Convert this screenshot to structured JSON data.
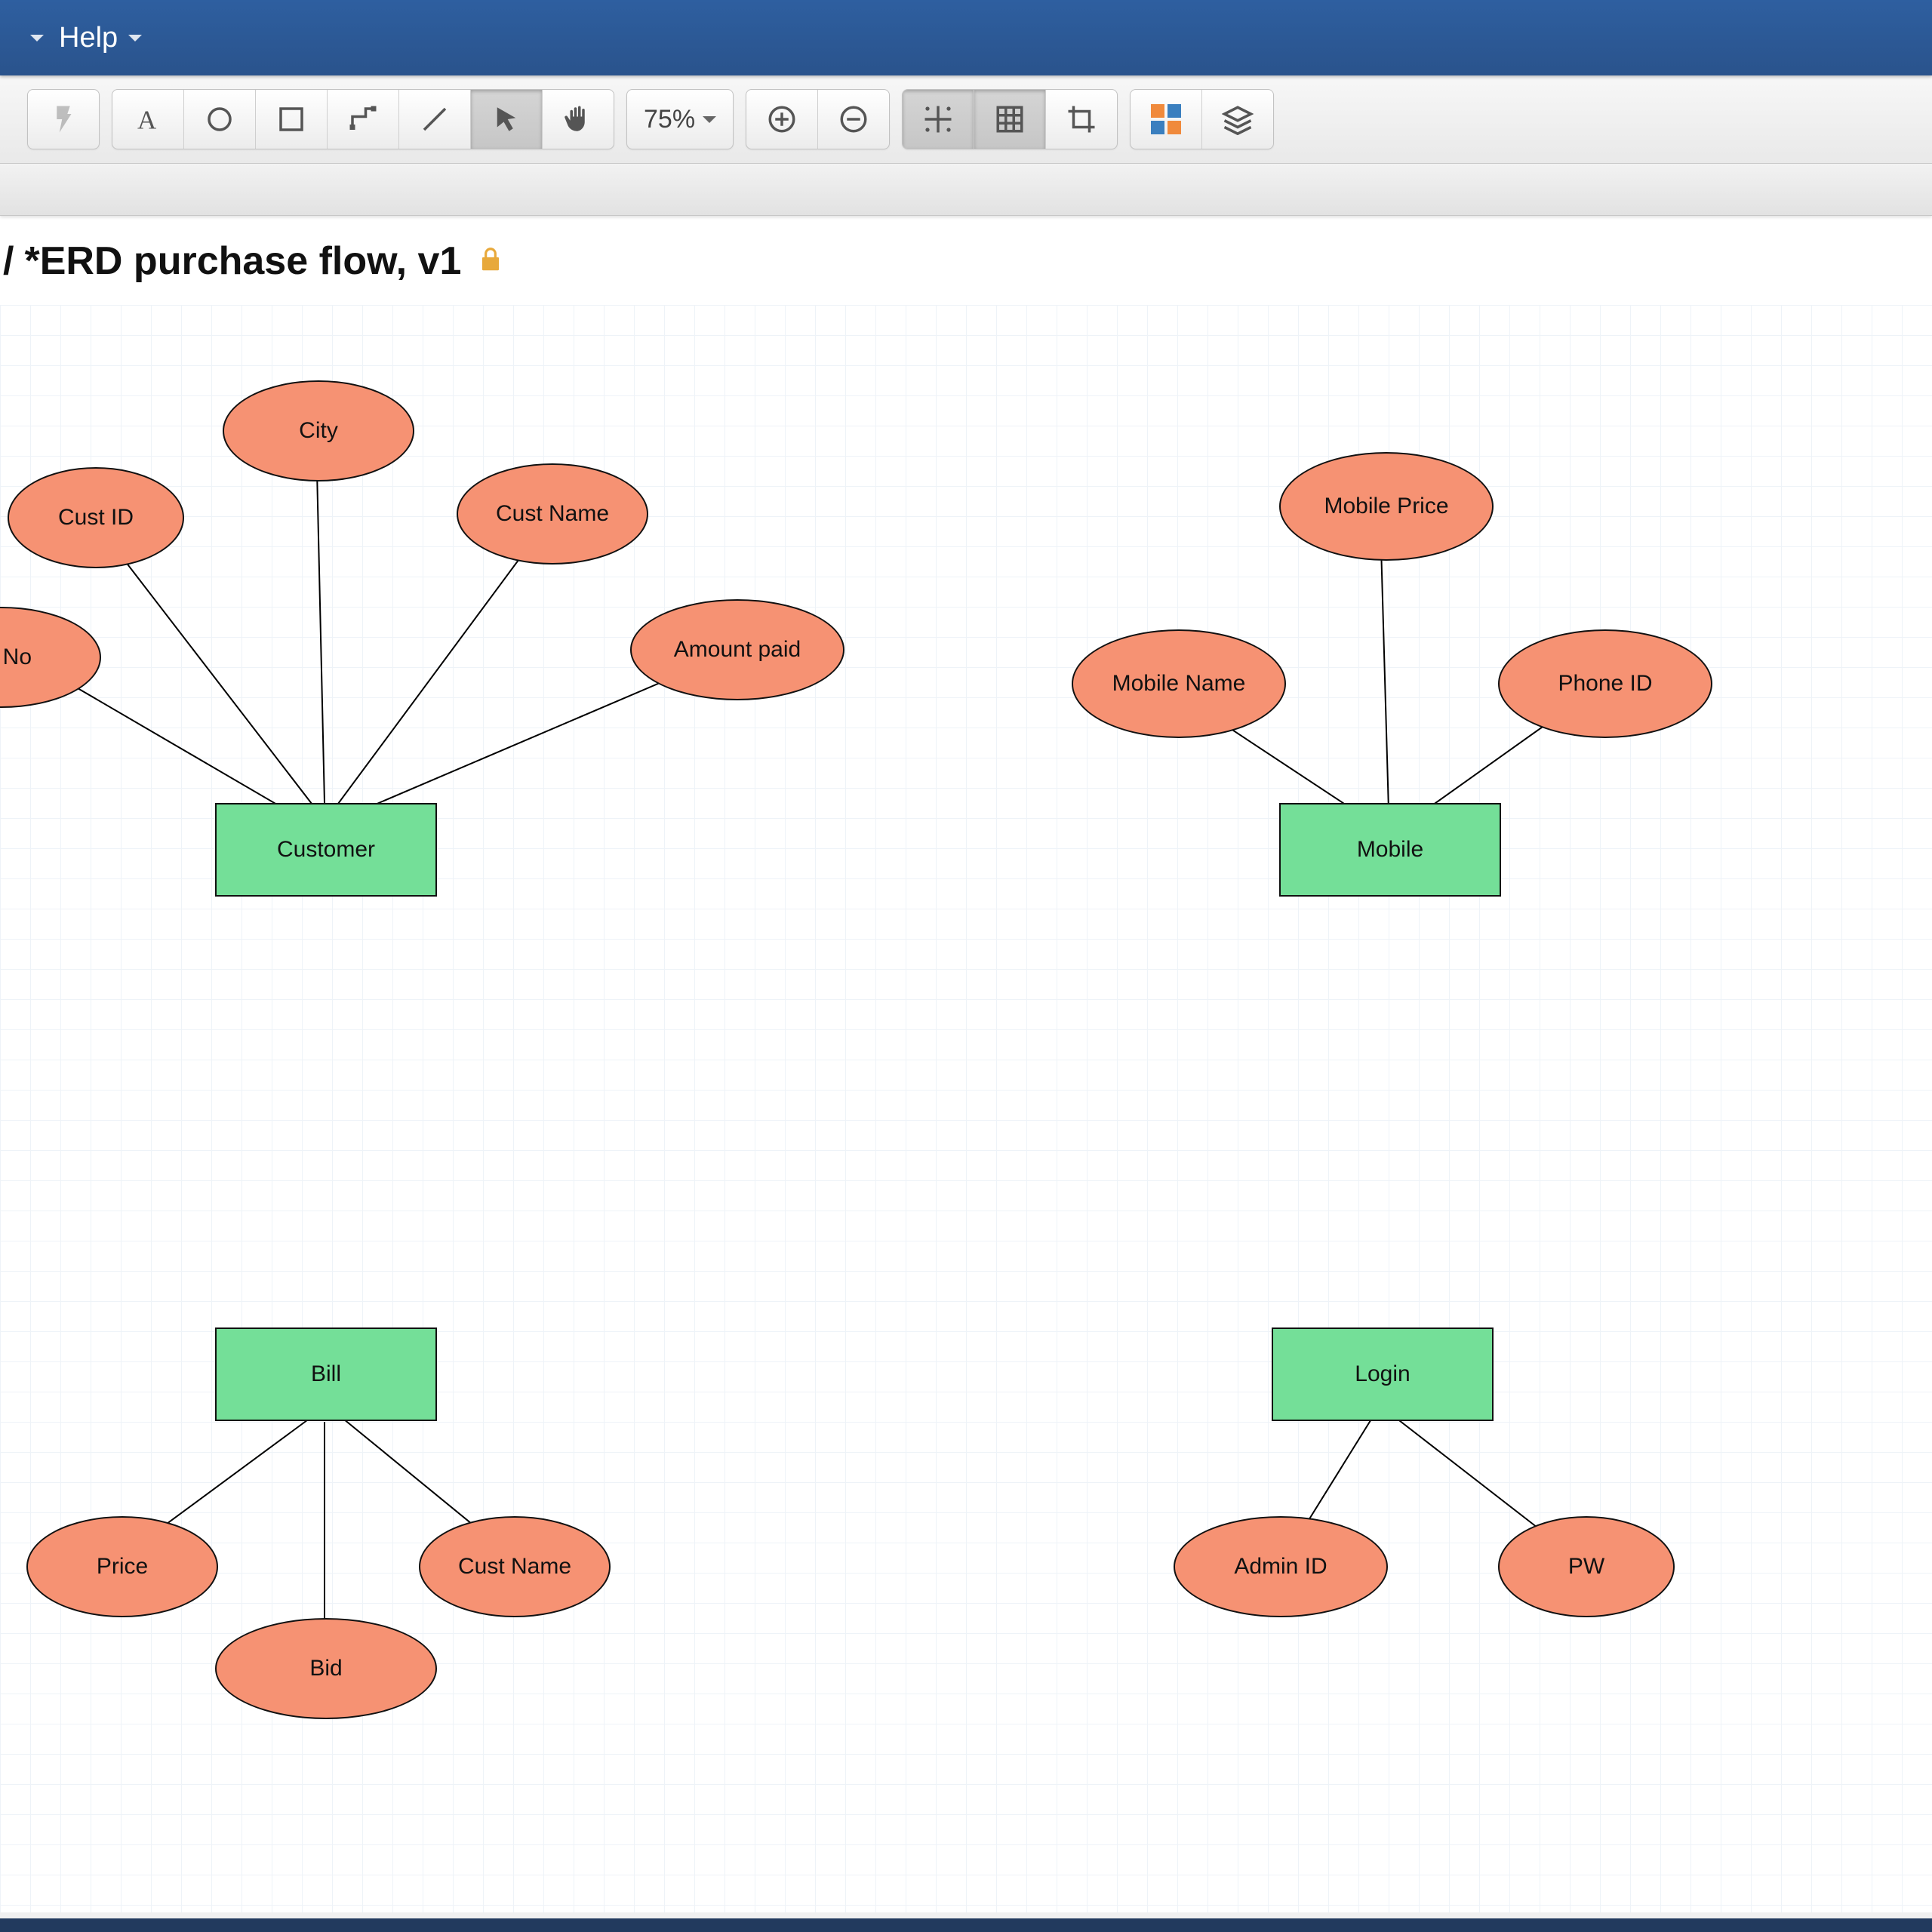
{
  "menubar": {
    "help": "Help"
  },
  "toolbar": {
    "zoom_label": "75%"
  },
  "breadcrumb": {
    "slash": "/"
  },
  "doc": {
    "title": "*ERD purchase flow, v1",
    "locked_icon": "lock-icon"
  },
  "erd": {
    "customer": {
      "entity": "Customer",
      "attrs": {
        "phone_no": "ne No",
        "cust_id": "Cust ID",
        "city": "City",
        "cust_name": "Cust Name",
        "amount_paid": "Amount paid"
      }
    },
    "mobile": {
      "entity": "Mobile",
      "attrs": {
        "mobile_name": "Mobile Name",
        "mobile_price": "Mobile Price",
        "phone_id": "Phone ID"
      }
    },
    "bill": {
      "entity": "Bill",
      "attrs": {
        "price": "Price",
        "bid": "Bid",
        "cust_name": "Cust Name"
      }
    },
    "login": {
      "entity": "Login",
      "attrs": {
        "admin_id": "Admin ID",
        "pw": "PW"
      }
    }
  }
}
